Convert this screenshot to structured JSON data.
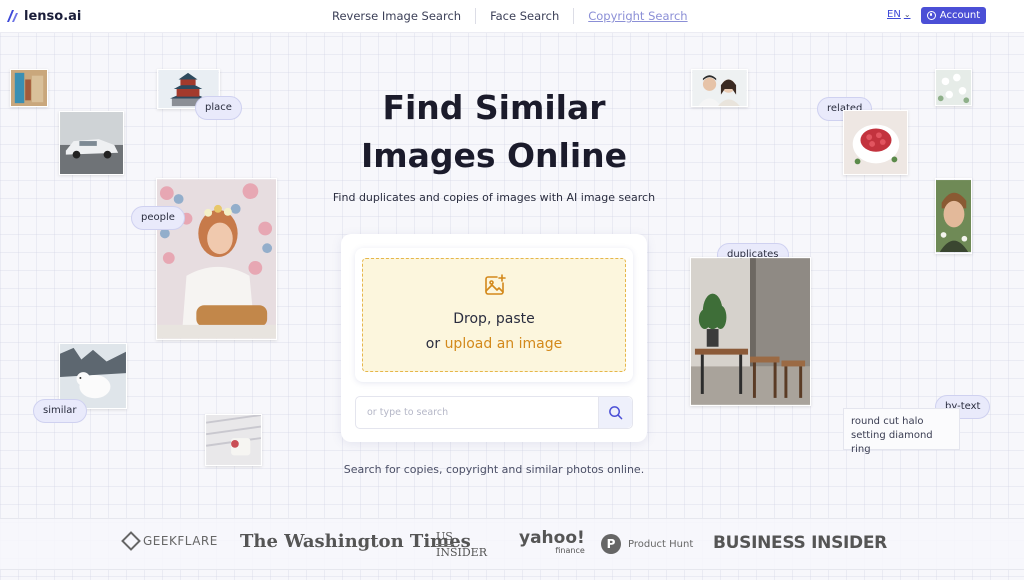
{
  "header": {
    "brand": "lenso.ai",
    "nav": [
      "Reverse Image Search",
      "Face Search",
      "Copyright Search"
    ],
    "active_nav": "Copyright Search",
    "language": "EN",
    "account_label": "Account"
  },
  "hero": {
    "title_line1": "Find Similar",
    "title_line2": "Images Online",
    "subtitle": "Find duplicates and copies of images with AI image search"
  },
  "upload": {
    "line1": "Drop, paste",
    "line2_prefix": "or ",
    "line2_link": "upload an image",
    "search_placeholder": "or type to search"
  },
  "footer_text": "Search for copies, copyright and similar photos online.",
  "tags": {
    "place": "place",
    "people": "people",
    "similar": "similar",
    "related": "related",
    "duplicates": "duplicates",
    "by_text": "by-text"
  },
  "text_note": {
    "line1": "round cut halo",
    "line2": "setting diamond ring"
  },
  "press": {
    "geekflare": "GEEKFLARE",
    "washington_times": "The Washington Times",
    "us_insider_top": "US",
    "us_insider_bottom": "INSIDER",
    "yahoo": "yahoo!",
    "yahoo_sub": "finance",
    "product_hunt": "Product Hunt",
    "product_hunt_mark": "P",
    "business_insider": "BUSINESS INSIDER"
  },
  "colors": {
    "accent": "#4b4fd6",
    "upload_link": "#d3891b",
    "dropzone_bg": "#fcf6dd",
    "tag_bg": "#e9eafb"
  }
}
